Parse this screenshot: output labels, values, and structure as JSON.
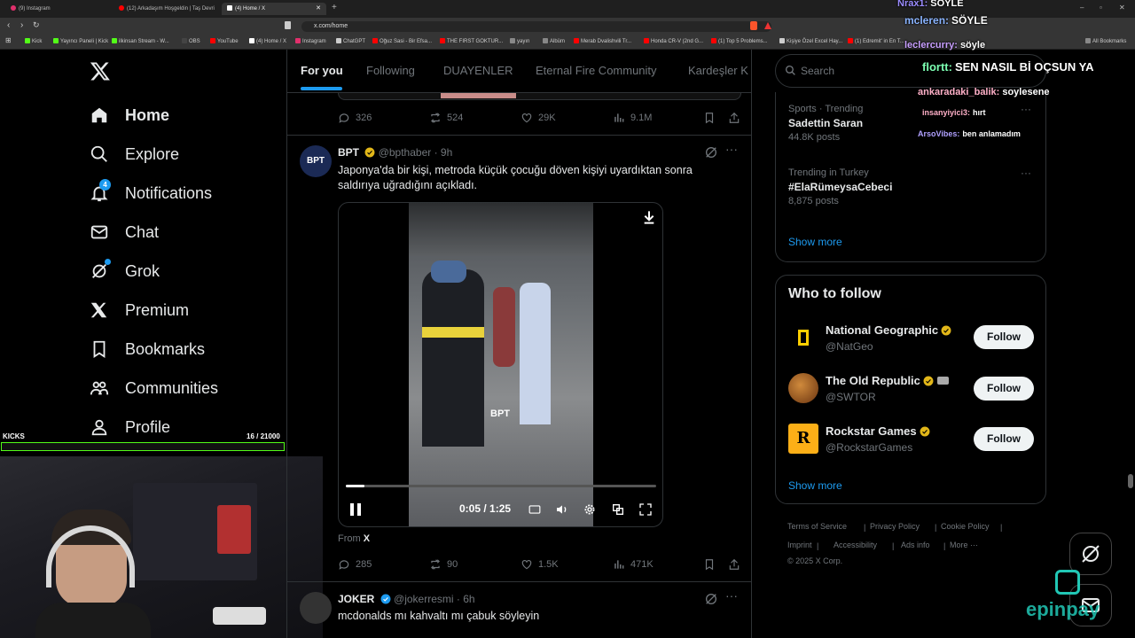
{
  "browser": {
    "tabs": [
      {
        "label": "(9) Instagram",
        "color": "#e1306c"
      },
      {
        "label": "(12) Arkadaşım Hoşgeldin | Taş Devri",
        "color": "#ff0000"
      },
      {
        "label": "(4) Home / X",
        "color": "#ffffff",
        "active": true
      }
    ],
    "url": "x.com/home",
    "bookmarks": [
      {
        "label": "Kick",
        "color": "#53fc18"
      },
      {
        "label": "Yayıncı Paneli | Kick",
        "color": "#53fc18"
      },
      {
        "label": "ilkinsan Stream - W...",
        "color": "#53fc18"
      },
      {
        "label": "OBS",
        "color": "#444444"
      },
      {
        "label": "YouTube",
        "color": "#ff0000"
      },
      {
        "label": "(4) Home / X",
        "color": "#ffffff"
      },
      {
        "label": "Instagram",
        "color": "#e1306c"
      },
      {
        "label": "ChatGPT",
        "color": "#cccccc"
      },
      {
        "label": "Oğuz Sasi - Bir Efsa...",
        "color": "#ff0000"
      },
      {
        "label": "THE FIRST GOKTUR...",
        "color": "#ff0000"
      },
      {
        "label": "yayın",
        "color": "#888888"
      },
      {
        "label": "Albüm",
        "color": "#888888"
      },
      {
        "label": "Merab Dvalishvili Tr...",
        "color": "#ff0000"
      },
      {
        "label": "Honda CR-V (2nd G...",
        "color": "#ff0000"
      },
      {
        "label": "(1) Top 5 Problems...",
        "color": "#ff0000"
      },
      {
        "label": "Kişiye Özel Excel Hay...",
        "color": "#cccccc"
      },
      {
        "label": "(1) Edremit' in En T...",
        "color": "#ff0000"
      },
      {
        "label": "All Bookmarks",
        "color": "#888888"
      }
    ]
  },
  "nav": {
    "items": [
      {
        "label": "Home",
        "icon": "home-icon"
      },
      {
        "label": "Explore",
        "icon": "search-icon"
      },
      {
        "label": "Notifications",
        "icon": "bell-icon",
        "badge": "4"
      },
      {
        "label": "Chat",
        "icon": "mail-icon"
      },
      {
        "label": "Grok",
        "icon": "grok-icon"
      },
      {
        "label": "Premium",
        "icon": "x-logo-icon"
      },
      {
        "label": "Bookmarks",
        "icon": "bookmark-icon"
      },
      {
        "label": "Communities",
        "icon": "people-icon"
      },
      {
        "label": "Profile",
        "icon": "person-icon"
      }
    ]
  },
  "kicks": {
    "label": "KICKS",
    "count": "16",
    "total": "/ 21000"
  },
  "feed": {
    "tabs": [
      "For you",
      "Following",
      "DUAYENLER",
      "Eternal Fire Community",
      "Kardeşler K"
    ],
    "post_top": {
      "replies": "326",
      "reposts": "524",
      "likes": "29K",
      "views": "9.1M"
    },
    "post_main": {
      "author": "BPT",
      "handle": "@bpthaber",
      "time": "· 9h",
      "avatar_text": "BPT",
      "text": "Japonya'da bir kişi, metroda küçük çocuğu döven kişiyi uyardıktan sonra saldırıya uğradığını açıkladı.",
      "video_time": "0:05 / 1:25",
      "video_progress": 0.06,
      "from_label": "From",
      "from_source": "X",
      "replies": "285",
      "reposts": "90",
      "likes": "1.5K",
      "views": "471K"
    },
    "post_next": {
      "author": "JOKER",
      "handle": "@jokerresmi",
      "time": "· 6h",
      "text": "mcdonalds mı kahvaltı mı çabuk söyleyin"
    }
  },
  "sidebar": {
    "search_placeholder": "Search",
    "trends": [
      {
        "category": "Sports · Trending",
        "name": "Sadettin Saran",
        "count": "44.8K posts"
      },
      {
        "category": "Trending in Turkey",
        "name": "#ElaRümeysaCebeci",
        "count": "8,875 posts"
      }
    ],
    "show_more": "Show more",
    "who_to_follow_title": "Who to follow",
    "suggestions": [
      {
        "name": "National Geographic",
        "handle": "@NatGeo",
        "button": "Follow"
      },
      {
        "name": "The Old Republic",
        "handle": "@SWTOR",
        "button": "Follow"
      },
      {
        "name": "Rockstar Games",
        "handle": "@RockstarGames",
        "button": "Follow"
      }
    ],
    "show_more_2": "Show more",
    "footer": [
      "Terms of Service",
      "Privacy Policy",
      "Cookie Policy",
      "Imprint",
      "Accessibility",
      "Ads info",
      "More ···",
      "© 2025 X Corp."
    ]
  },
  "chat_overlay": [
    {
      "user": "Nrax1:",
      "msg": "SÖYLE",
      "color": "#9b8cff"
    },
    {
      "user": "mcleren:",
      "msg": "SÖYLE",
      "color": "#8ab4ff"
    },
    {
      "user": "leclercurry:",
      "msg": "söyle",
      "color": "#c9a0ff"
    },
    {
      "user": "flortt:",
      "msg": "SEN NASIL Bİ OÇSUN YA",
      "color": "#7cffb2"
    },
    {
      "user": "ankaradaki_balik:",
      "msg": "soylesene",
      "color": "#ffb0c8"
    },
    {
      "user": "insanyiyici3:",
      "msg": "hırt",
      "color": "#ffb0c8"
    },
    {
      "user": "ArsoVibes:",
      "msg": "ben anlamadım",
      "color": "#b0a0ff"
    }
  ],
  "watermark": "epinpay",
  "colors": {
    "accent": "#1d9bf0",
    "gold": "#e2b719",
    "kick_green": "#53fc18"
  }
}
